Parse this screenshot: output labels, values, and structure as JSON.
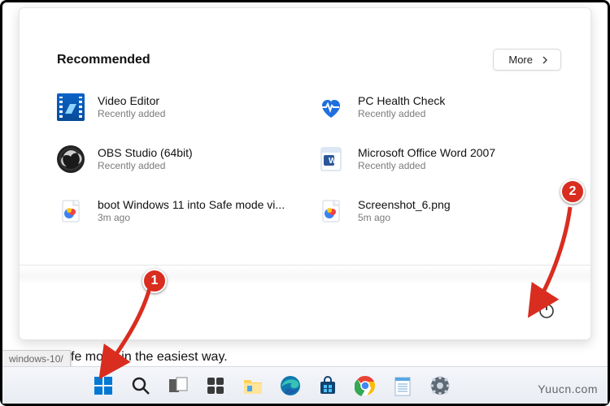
{
  "section": {
    "title": "Recommended",
    "more_label": "More"
  },
  "items": [
    {
      "label": "Video Editor",
      "sub": "Recently added"
    },
    {
      "label": "PC Health Check",
      "sub": "Recently added"
    },
    {
      "label": "OBS Studio (64bit)",
      "sub": "Recently added"
    },
    {
      "label": "Microsoft Office Word 2007",
      "sub": "Recently added"
    },
    {
      "label": "boot Windows 11 into Safe mode vi...",
      "sub": "3m ago"
    },
    {
      "label": "Screenshot_6.png",
      "sub": "5m ago"
    }
  ],
  "power_name": "power-button",
  "background": {
    "tab_fragment": "windows-10/",
    "text_fragment": "fe mode in the easiest way."
  },
  "callouts": {
    "one": "1",
    "two": "2"
  },
  "watermark": "Yuucn.com"
}
